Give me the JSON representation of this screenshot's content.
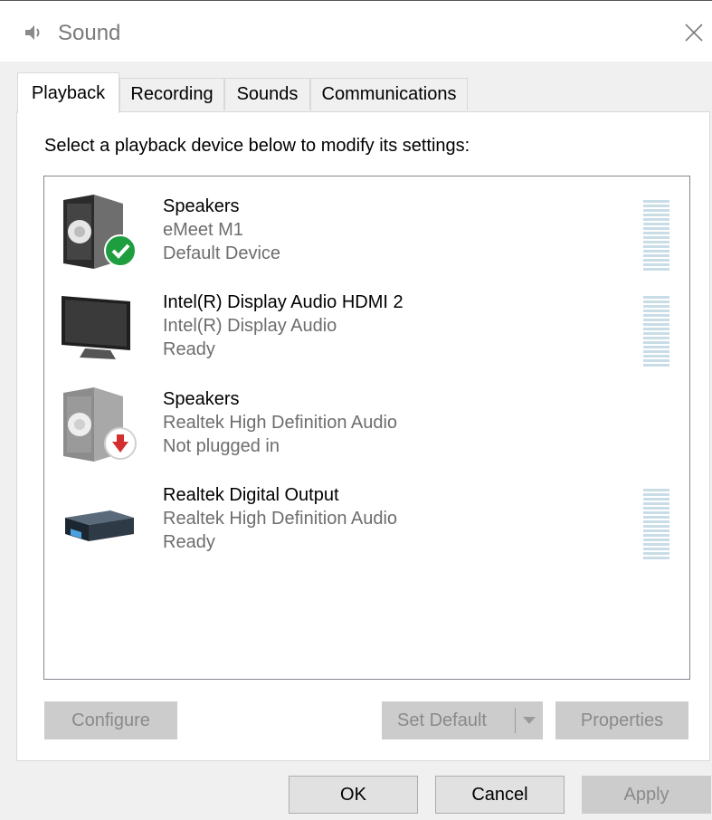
{
  "window": {
    "title": "Sound"
  },
  "tabs": [
    {
      "label": "Playback",
      "active": true
    },
    {
      "label": "Recording",
      "active": false
    },
    {
      "label": "Sounds",
      "active": false
    },
    {
      "label": "Communications",
      "active": false
    }
  ],
  "playback": {
    "instruction": "Select a playback device below to modify its settings:",
    "devices": [
      {
        "name": "Speakers",
        "driver": "eMeet M1",
        "status": "Default Device",
        "icon": "speaker-default-icon"
      },
      {
        "name": "Intel(R) Display Audio HDMI 2",
        "driver": "Intel(R) Display Audio",
        "status": "Ready",
        "icon": "monitor-icon"
      },
      {
        "name": "Speakers",
        "driver": "Realtek High Definition Audio",
        "status": "Not plugged in",
        "icon": "speaker-unplugged-icon"
      },
      {
        "name": "Realtek Digital Output",
        "driver": "Realtek High Definition Audio",
        "status": "Ready",
        "icon": "digital-output-icon"
      }
    ],
    "buttons": {
      "configure": {
        "label": "Configure",
        "enabled": false
      },
      "set_default": {
        "label": "Set Default",
        "enabled": false
      },
      "properties": {
        "label": "Properties",
        "enabled": false
      }
    }
  },
  "footer": {
    "ok": {
      "label": "OK",
      "enabled": true
    },
    "cancel": {
      "label": "Cancel",
      "enabled": true
    },
    "apply": {
      "label": "Apply",
      "enabled": false
    }
  },
  "colors": {
    "accent_green": "#1e9e3e",
    "unplugged_red": "#d32f2f",
    "meter_bar": "#c8dde6"
  }
}
